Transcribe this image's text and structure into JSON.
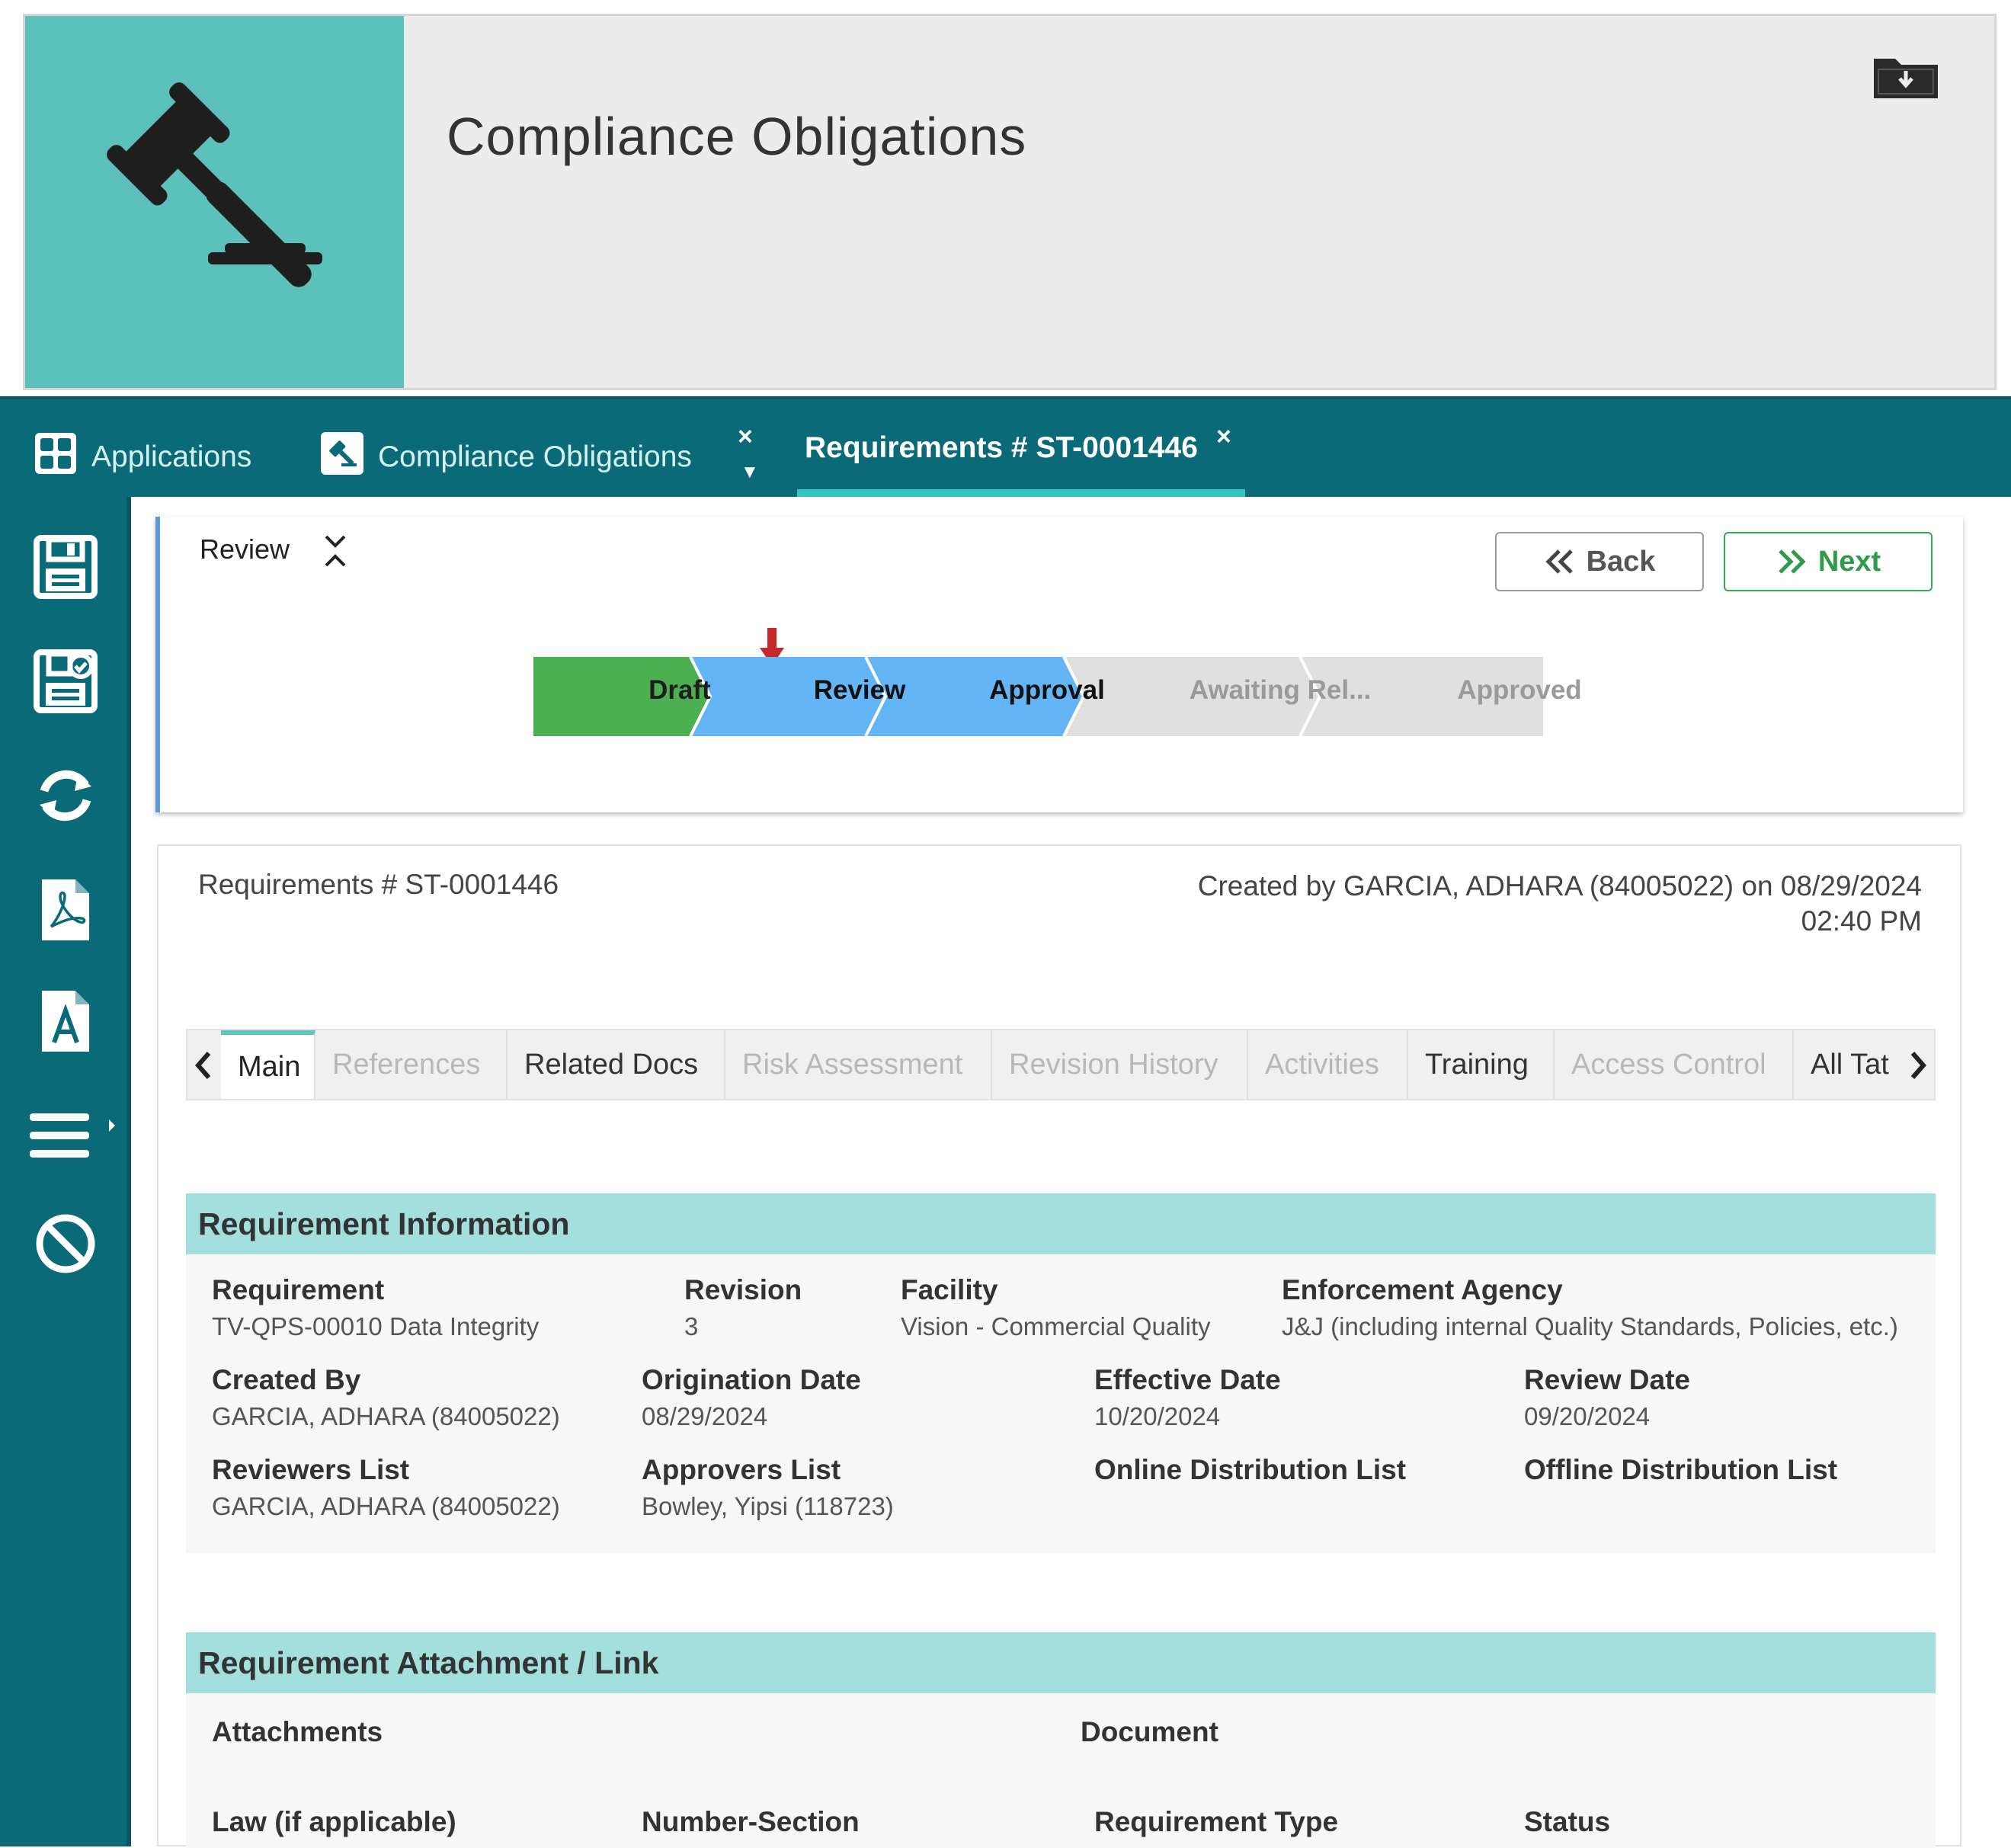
{
  "banner": {
    "title": "Compliance Obligations",
    "logo_icon": "gavel-icon",
    "action_icon": "folder-download-icon"
  },
  "topnav": {
    "applications": "Applications",
    "compliance": "Compliance Obligations",
    "requirement_tab": "Requirements # ST-0001446",
    "close_glyph": "×",
    "dropdown_glyph": "▼"
  },
  "sidebar": {
    "buttons": [
      "save-icon",
      "save-and-check-icon",
      "refresh-icon",
      "pdf-icon",
      "document-a-icon",
      "menu-icon",
      "cancel-icon"
    ]
  },
  "workflow": {
    "current_label": "Review",
    "back_label": "Back",
    "next_label": "Next",
    "steps": [
      {
        "label": "Draft",
        "state": "done",
        "color": "#4caf50"
      },
      {
        "label": "Review",
        "state": "current",
        "color": "#64b5f6"
      },
      {
        "label": "Approval",
        "state": "upcoming",
        "color": "#64b5f6"
      },
      {
        "label": "Awaiting Rel...",
        "state": "inactive",
        "color": "#e0e0e0"
      },
      {
        "label": "Approved",
        "state": "inactive",
        "color": "#e0e0e0"
      }
    ]
  },
  "record": {
    "id": "Requirements # ST-0001446",
    "created_line1": "Created by GARCIA, ADHARA (84005022) on  08/29/2024",
    "created_line2": "02:40 PM"
  },
  "tabs": [
    "Main",
    "References",
    "Related Docs",
    "Risk Assessment",
    "Revision History",
    "Activities",
    "Training",
    "Access Control",
    "All Tat"
  ],
  "requirement_info": {
    "title": "Requirement Information",
    "requirement_label": "Requirement",
    "requirement_value": "TV-QPS-00010 Data Integrity",
    "revision_label": "Revision",
    "revision_value": "3",
    "facility_label": "Facility",
    "facility_value": "Vision - Commercial Quality",
    "agency_label": "Enforcement Agency",
    "agency_value": "J&J (including internal Quality Standards, Policies, etc.)",
    "created_by_label": "Created By",
    "created_by_value": "GARCIA, ADHARA (84005022)",
    "origination_label": "Origination Date",
    "origination_value": "08/29/2024",
    "effective_label": "Effective Date",
    "effective_value": "10/20/2024",
    "review_label": "Review Date",
    "review_value": "09/20/2024",
    "reviewers_label": "Reviewers List",
    "reviewers_value": "GARCIA, ADHARA (84005022)",
    "approvers_label": "Approvers List",
    "approvers_value": "Bowley, Yipsi (118723)",
    "online_dist_label": "Online Distribution List",
    "offline_dist_label": "Offline Distribution List"
  },
  "attachment": {
    "title": "Requirement Attachment / Link",
    "attachments_label": "Attachments",
    "document_label": "Document",
    "law_label": "Law (if applicable)",
    "number_section_label": "Number-Section",
    "req_type_label": "Requirement Type",
    "status_label": "Status"
  }
}
